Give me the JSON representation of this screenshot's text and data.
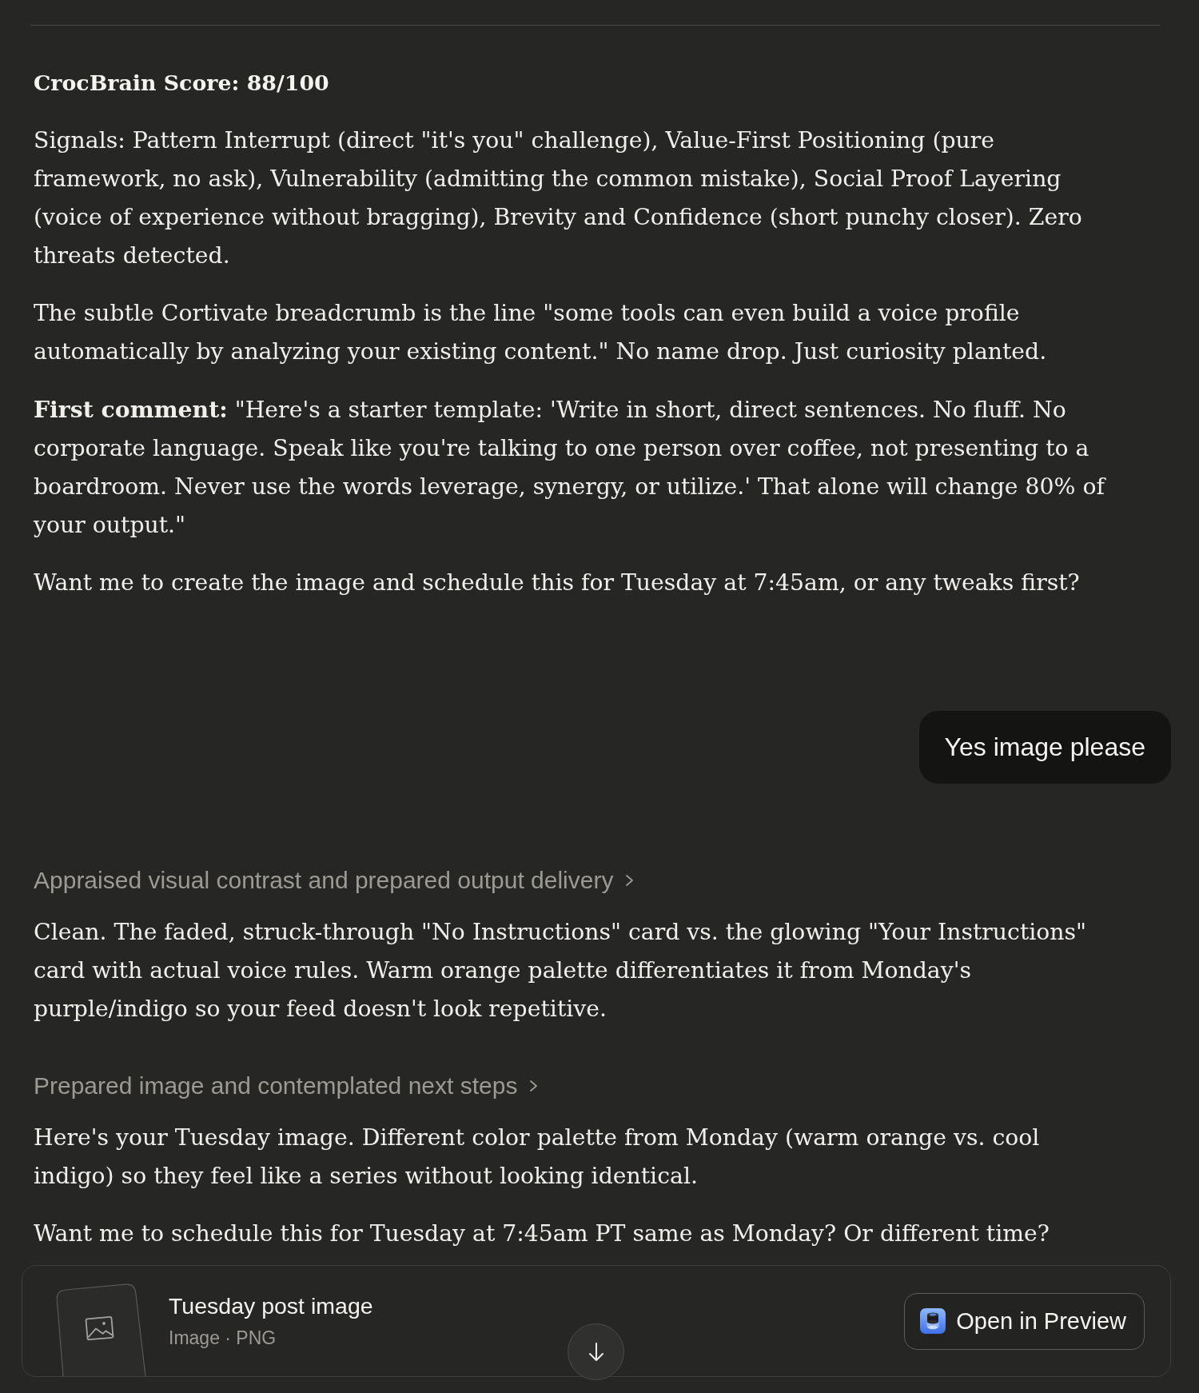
{
  "conversation": [
    {
      "kind": "assistant",
      "blocks": [
        {
          "kind": "heading",
          "text": "CrocBrain Score: 88/100"
        },
        {
          "kind": "paragraph",
          "text": "Signals: Pattern Interrupt (direct \"it's you\" challenge), Value-First Positioning (pure framework, no ask), Vulnerability (admitting the common mistake), Social Proof Layering (voice of experience without bragging), Brevity and Confidence (short punchy closer). Zero threats detected."
        },
        {
          "kind": "paragraph",
          "text": "The subtle Cortivate breadcrumb is the line \"some tools can even build a voice profile automatically by analyzing your existing content.\" No name drop. Just curiosity planted."
        },
        {
          "kind": "paragraph",
          "text": "**First comment:** \"Here's a starter template: 'Write in short, direct sentences. No fluff. No corporate language. Speak like you're talking to one person over coffee, not presenting to a boardroom. Never use the words leverage, synergy, or utilize.' That alone will change 80% of your output.\""
        },
        {
          "kind": "paragraph",
          "text": "Want me to create the image and schedule this for Tuesday at 7:45am, or any tweaks first?"
        }
      ]
    },
    {
      "kind": "user",
      "text": "Yes image please"
    },
    {
      "kind": "assistant",
      "blocks": [
        {
          "kind": "thinking",
          "text": "Appraised visual contrast and prepared output delivery",
          "expanded": false
        },
        {
          "kind": "paragraph",
          "text": "Clean. The faded, struck-through \"No Instructions\" card vs. the glowing \"Your Instructions\" card with actual voice rules. Warm orange palette differentiates it from Monday's purple/indigo so your feed doesn't look repetitive."
        },
        {
          "kind": "thinking",
          "text": "Prepared image and contemplated next steps",
          "expanded": false
        },
        {
          "kind": "paragraph",
          "text": "Here's your Tuesday image. Different color palette from Monday (warm orange vs. cool indigo) so they feel like a series without looking identical."
        },
        {
          "kind": "paragraph",
          "text": "Want me to schedule this for Tuesday at 7:45am PT same as Monday? Or different time?"
        }
      ]
    }
  ],
  "attachment": {
    "title": "Tuesday post image",
    "meta": "Image · PNG",
    "action": "Open in Preview"
  }
}
